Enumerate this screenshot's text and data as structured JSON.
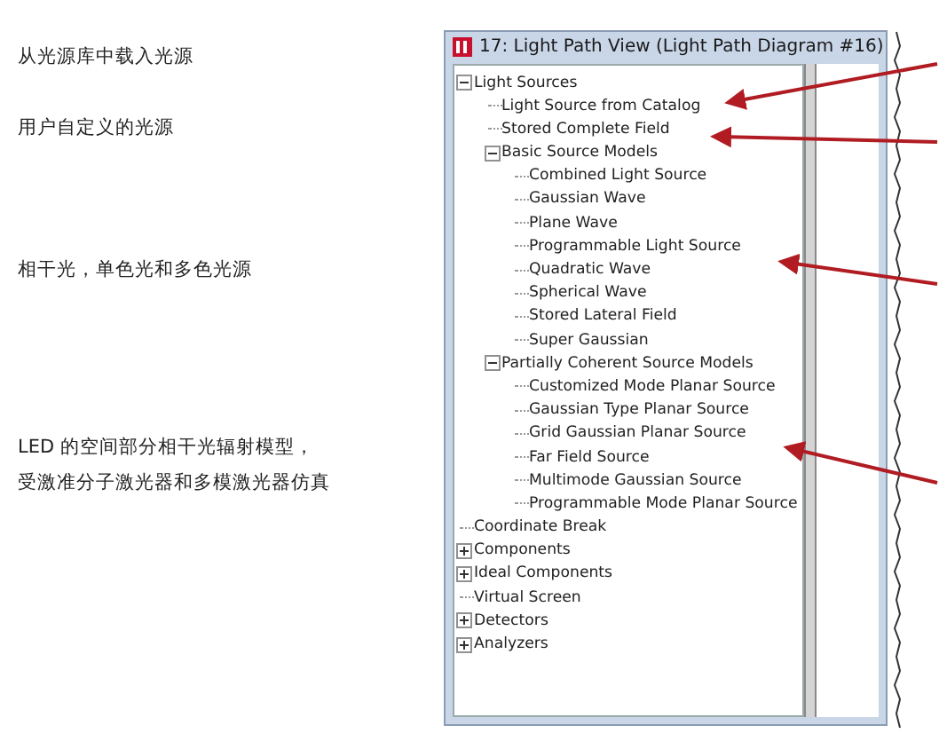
{
  "notes": [
    {
      "text": "从光源库中载入光源"
    },
    {
      "text": "用户自定义的光源"
    },
    {
      "text": "相干光，单色光和多色光源"
    },
    {
      "text": "LED 的空间部分相干光辐射模型，"
    },
    {
      "text": "受激准分子激光器和多模激光器仿真"
    }
  ],
  "window": {
    "title": "17: Light Path View (Light Path Diagram #16)"
  },
  "tree": [
    {
      "label": "Light Sources",
      "expanded": true,
      "children": [
        {
          "label": "Light Source from Catalog"
        },
        {
          "label": "Stored Complete Field"
        },
        {
          "label": "Basic Source Models",
          "expanded": true,
          "children": [
            {
              "label": "Combined Light Source"
            },
            {
              "label": "Gaussian Wave"
            },
            {
              "label": "Plane Wave"
            },
            {
              "label": "Programmable Light Source"
            },
            {
              "label": "Quadratic Wave"
            },
            {
              "label": "Spherical Wave"
            },
            {
              "label": "Stored Lateral Field"
            },
            {
              "label": "Super Gaussian"
            }
          ]
        },
        {
          "label": "Partially Coherent Source Models",
          "expanded": true,
          "children": [
            {
              "label": "Customized Mode Planar Source"
            },
            {
              "label": "Gaussian Type Planar Source"
            },
            {
              "label": "Grid Gaussian Planar Source"
            },
            {
              "label": "Far Field Source"
            },
            {
              "label": "Multimode Gaussian Source"
            },
            {
              "label": "Programmable Mode Planar Source"
            }
          ]
        }
      ]
    },
    {
      "label": "Coordinate Break"
    },
    {
      "label": "Components",
      "expanded": false
    },
    {
      "label": "Ideal Components",
      "expanded": false
    },
    {
      "label": "Virtual Screen"
    },
    {
      "label": "Detectors",
      "expanded": false
    },
    {
      "label": "Analyzers",
      "expanded": false
    }
  ]
}
